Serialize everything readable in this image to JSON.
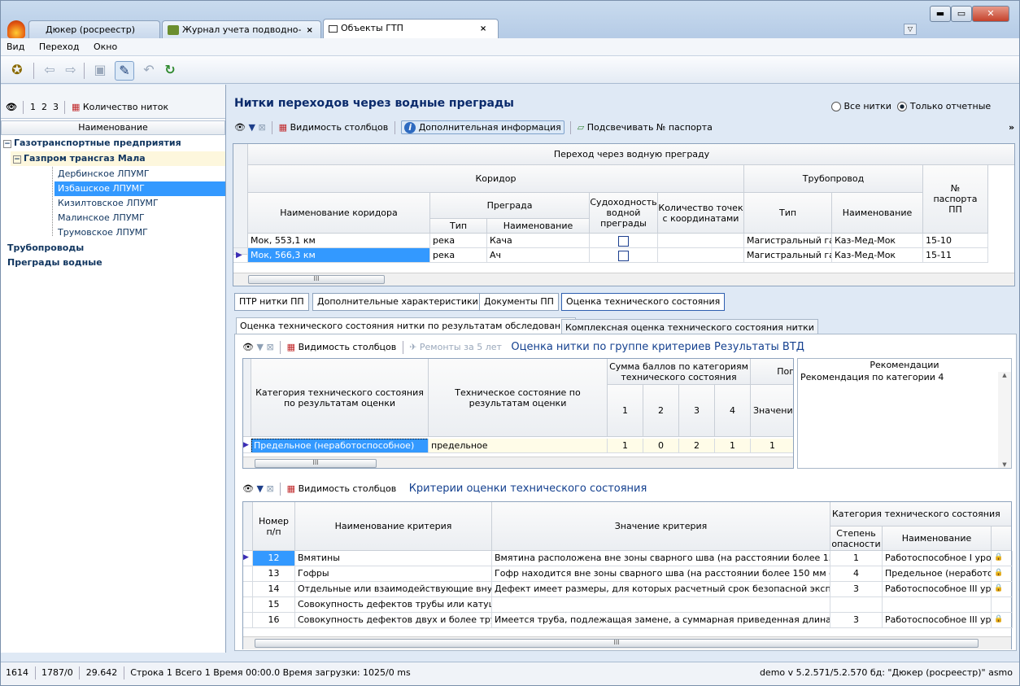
{
  "tabs": [
    {
      "label": "Дюкер (росреестр)"
    },
    {
      "label": "Журнал учета подводно-",
      "close": "×"
    },
    {
      "label": "Объекты ГТП",
      "close": "×"
    }
  ],
  "menu": [
    "Вид",
    "Переход",
    "Окно"
  ],
  "left": {
    "tool_nums": "1  2  3",
    "count_label": "Количество ниток",
    "col_header": "Наименование",
    "tree": [
      {
        "label": "Газотранспортные предприятия",
        "expander": "−"
      },
      {
        "label": "Газпром трансгаз Мала",
        "expander": "−"
      },
      {
        "label": "Дербинское ЛПУМГ"
      },
      {
        "label": "Избашское ЛПУМГ"
      },
      {
        "label": "Кизилтовское ЛПУМГ"
      },
      {
        "label": "Малинское ЛПУМГ"
      },
      {
        "label": "Трумовское ЛПУМГ"
      },
      {
        "label": "Трубопроводы"
      },
      {
        "label": "Преграды водные"
      }
    ]
  },
  "main": {
    "title": "Нитки переходов через водные преграды",
    "radio_all": "Все нитки",
    "radio_report": "Только отчетные",
    "toolbar": {
      "visibility": "Видимость столбцов",
      "info": "Дополнительная информация",
      "highlight": "Подсвечивать № паспорта"
    },
    "top_grid": {
      "h_group": "Переход через водную преграду",
      "h_corridor": "Коридор",
      "h_pipeline": "Трубопровод",
      "h_passport": "№ паспорта ПП",
      "h_corridor_name": "Наименование коридора",
      "h_barrier": "Преграда",
      "h_navig": "Судоходность водной преграды",
      "h_points": "Количество точек с координатами",
      "h_type": "Тип",
      "h_name": "Наименование",
      "h_btype": "Тип",
      "h_bname": "Наименование",
      "rows": [
        {
          "corridor": "Мок, 553,1 км",
          "btype": "река",
          "bname": "Кача",
          "ptype": "Магистральный га",
          "pname": "Каз-Мед-Мок",
          "passport": "15-10"
        },
        {
          "corridor": "Мок, 566,3 км",
          "btype": "река",
          "bname": "Ач",
          "ptype": "Магистральный га",
          "pname": "Каз-Мед-Мок",
          "passport": "15-11"
        }
      ]
    },
    "ptabs": [
      "ПТР нитки ПП",
      "Дополнительные характеристики",
      "Документы ПП",
      "Оценка технического состояния"
    ],
    "stabs": [
      "Оценка технического состояния нитки по результатам обследования",
      "Комплексная оценка технического состояния нитки"
    ],
    "eval": {
      "visibility": "Видимость столбцов",
      "repairs": "Ремонты за 5 лет",
      "subtitle": "Оценка нитки по группе критериев Результаты ВТД",
      "h_cat": "Категория технического состояния по результатам оценки",
      "h_state": "Техническое состояние по результатам оценки",
      "h_sum": "Сумма баллов по категориям технического состояния",
      "h_po": "Пог",
      "h_val": "Значени",
      "nums": [
        "1",
        "2",
        "3",
        "4"
      ],
      "row": {
        "cat": "Предельное (неработоспособное)",
        "state": "предельное",
        "s1": "1",
        "s2": "0",
        "s3": "2",
        "s4": "1",
        "val": "1"
      },
      "rec_header": "Рекомендации",
      "rec_text": "Рекомендация по категории 4"
    },
    "crit": {
      "visibility": "Видимость столбцов",
      "subtitle": "Критерии оценки технического состояния",
      "h_num": "Номер п/п",
      "h_name": "Наименование критерия",
      "h_value": "Значение критерия",
      "h_cat": "Категория технического состояния",
      "h_danger": "Степень опасности",
      "h_catname": "Наименование",
      "rows": [
        {
          "num": "12",
          "name": "Вмятины",
          "value": "Вмятина расположена вне зоны сварного шва (на расстоянии более 150",
          "danger": "1",
          "cat": "Работоспособное I уро"
        },
        {
          "num": "13",
          "name": "Гофры",
          "value": "Гофр находится вне зоны сварного шва (на расстоянии более 150 мм от г",
          "danger": "4",
          "cat": "Предельное (неработо"
        },
        {
          "num": "14",
          "name": "Отдельные или взаимодействующие внутр",
          "value": "Дефект имеет размеры, для которых расчетный срок безопасной эксплу",
          "danger": "3",
          "cat": "Работоспособное III ур"
        },
        {
          "num": "15",
          "name": "Совокупность дефектов трубы или катушк",
          "value": "",
          "danger": "",
          "cat": ""
        },
        {
          "num": "16",
          "name": "Совокупность дефектов двух и более труб",
          "value": "Имеется труба, подлежащая замене, а суммарная приведенная длина де",
          "danger": "3",
          "cat": "Работоспособное III ур"
        }
      ]
    }
  },
  "status": {
    "a": "1614",
    "b": "1787/0",
    "c": "29.642",
    "d": "Строка 1 Всего 1 Время 00:00.0  Время загрузки: 1025/0 ms",
    "right": "demo  v 5.2.571/5.2.570  бд: \"Дюкер (росреестр)\" asmo"
  }
}
